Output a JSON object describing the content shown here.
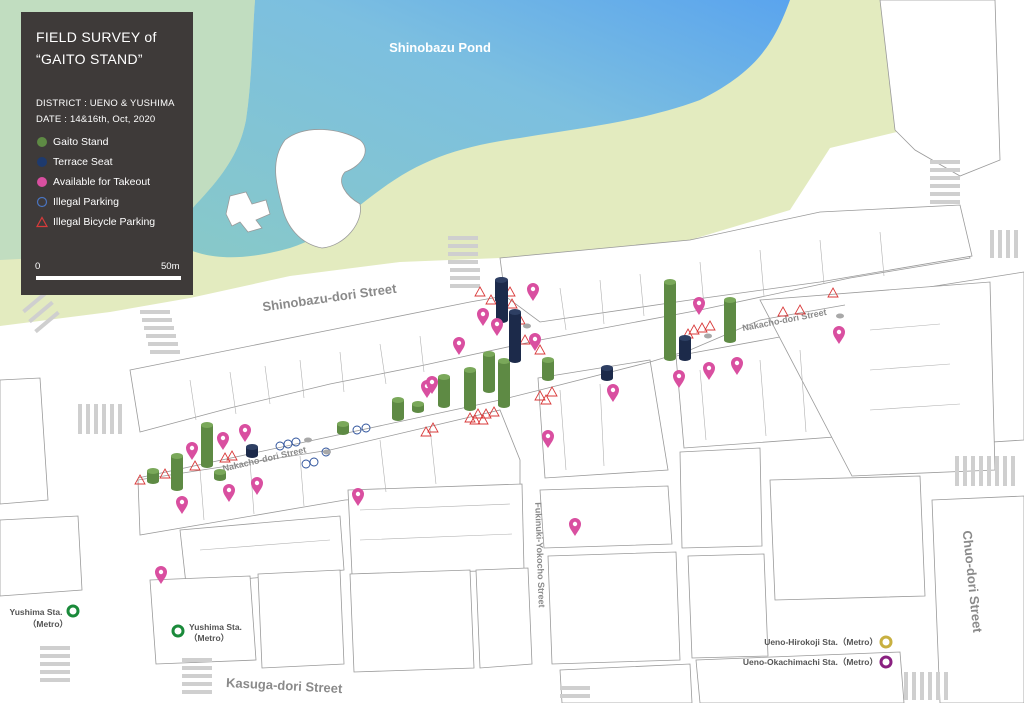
{
  "legend": {
    "title": "FIELD SURVEY of\n“GAITO STAND”",
    "district": "DISTRICT : UENO & YUSHIMA",
    "date": "DATE : 14&16th, Oct, 2020",
    "items": [
      {
        "label": "Gaito Stand",
        "icon": "green-dot-icon",
        "color": "#5a8a3a"
      },
      {
        "label": "Terrace Seat",
        "icon": "navy-dot-icon",
        "color": "#1e3a6e"
      },
      {
        "label": "Available for Takeout",
        "icon": "pink-dot-icon",
        "color": "#d94fa0"
      },
      {
        "label": "Illegal Parking",
        "icon": "blue-ring-icon",
        "color": "#2a4f9a"
      },
      {
        "label": "Illegal Bicycle Parking",
        "icon": "red-triangle-icon",
        "color": "#d93a3a"
      }
    ],
    "scale_start": "0",
    "scale_end": "50m"
  },
  "labels": {
    "pond": "Shinobazu Pond",
    "shinobazu_street": "Shinobazu-dori Street",
    "nakacho_west": "Nakacho-dori Street",
    "nakacho_east": "Nakacho-dori Street",
    "fukinuki": "Fukinuki-Yokocho Street",
    "chuo": "Chuo-dori Street",
    "kasuga": "Kasuga-dori Street",
    "yushima_sta_1_name": "Yushima Sta.",
    "yushima_sta_1_sub": "（Metro）",
    "yushima_sta_2_name": "Yushima Sta.",
    "yushima_sta_2_sub": "（Metro）",
    "ueno_hirokoji_sta": "Ueno-Hirokoji Sta.（Metro）",
    "ueno_okachimachi_sta": "Ueno-Okachimachi Sta.（Metro）"
  },
  "colors": {
    "park": "#e3ebbf",
    "water_light": "#7ec4d3",
    "water_dark": "#6aa8e6",
    "block": "#ffffff",
    "outline": "#9a9a9a",
    "gaito": "#5e8a44",
    "terrace": "#1c2a4a",
    "takeout": "#d94fa0",
    "parking": "#2a4f9a",
    "bicycle": "#d93a3a",
    "station_yushima": "#1a8a3a",
    "station_hirokoji": "#c8b040",
    "station_okachimachi": "#8a2080"
  }
}
